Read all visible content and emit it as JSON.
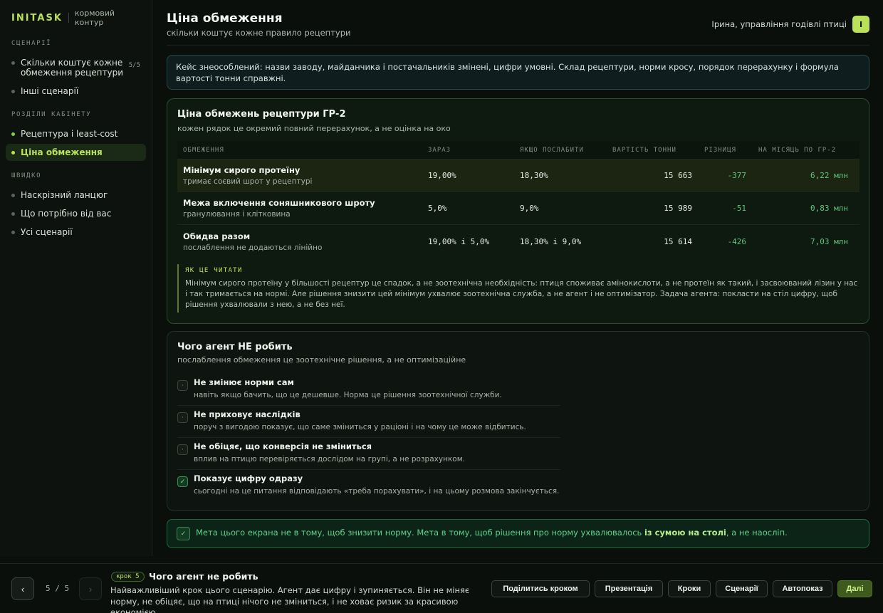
{
  "brand": {
    "name": "INITASK",
    "subtitle": "кормовий контур"
  },
  "sidebar": {
    "sections": [
      {
        "title": "СЦЕНАРІЇ",
        "items": [
          {
            "label": "Скільки коштує кожне обмеження рецептури",
            "count": "5/5"
          },
          {
            "label": "Інші сценарії"
          }
        ]
      },
      {
        "title": "РОЗДІЛИ КАБІНЕТУ",
        "items": [
          {
            "label": "Рецептура і least-cost"
          },
          {
            "label": "Ціна обмеження"
          }
        ]
      },
      {
        "title": "ШВИДКО",
        "items": [
          {
            "label": "Наскрізний ланцюг"
          },
          {
            "label": "Що потрібно від вас"
          },
          {
            "label": "Усі сценарії"
          }
        ]
      }
    ]
  },
  "header": {
    "title": "Ціна обмеження",
    "subtitle": "скільки коштує кожне правило рецептури",
    "user": "Ірина, управління годівлі птиці",
    "avatar": "І"
  },
  "notice": "Кейс знеособлений: назви заводу, майданчика і постачальників змінені, цифри умовні. Склад рецептури, норми кросу, порядок перерахунку і формула вартості тонни справжні.",
  "constraints_card": {
    "title": "Ціна обмежень рецептури ГР-2",
    "subtitle": "кожен рядок це окремий повний перерахунок, а не оцінка на око",
    "columns": [
      "ОБМЕЖЕННЯ",
      "ЗАРАЗ",
      "ЯКЩО ПОСЛАБИТИ",
      "ВАРТІСТЬ ТОННИ",
      "РІЗНИЦЯ",
      "НА МІСЯЦЬ ПО ГР-2"
    ],
    "rows": [
      {
        "name": "Мінімум сирого протеїну",
        "desc": "тримає соєвий шрот у рецептурі",
        "now": "19,00%",
        "relaxed": "18,30%",
        "cost": "15 663",
        "diff": "-377",
        "monthly": "6,22 млн"
      },
      {
        "name": "Межа включення соняшникового шроту",
        "desc": "гранулювання і клітковина",
        "now": "5,0%",
        "relaxed": "9,0%",
        "cost": "15 989",
        "diff": "-51",
        "monthly": "0,83 млн"
      },
      {
        "name": "Обидва разом",
        "desc": "послаблення не додаються лінійно",
        "now": "19,00% і 5,0%",
        "relaxed": "18,30% і 9,0%",
        "cost": "15 614",
        "diff": "-426",
        "monthly": "7,03 млн"
      }
    ],
    "howto_label": "ЯК ЦЕ ЧИТАТИ",
    "howto_text": "Мінімум сирого протеїну у більшості рецептур це спадок, а не зоотехнічна необхідність: птиця споживає амінокислоти, а не протеїн як такий, і засвоюваний лізин у нас і так тримається на нормі. Але рішення знизити цей мінімум ухвалює зоотехнічна служба, а не агент і не оптимізатор. Задача агента: покласти на стіл цифру, щоб рішення ухвалювали з нею, а не без неї."
  },
  "rules_card": {
    "title": "Чого агент НЕ робить",
    "subtitle": "послаблення обмеження це зоотехнічне рішення, а не оптимізаційне",
    "items": [
      {
        "title": "Не змінює норми сам",
        "desc": "навіть якщо бачить, що це дешевше. Норма це рішення зоотехнічної служби.",
        "mark": "·",
        "checked": false
      },
      {
        "title": "Не приховує наслідків",
        "desc": "поруч з вигодою показує, що саме зміниться у раціоні і на чому це може відбитись.",
        "mark": "·",
        "checked": false
      },
      {
        "title": "Не обіцяє, що конверсія не зміниться",
        "desc": "вплив на птицю перевіряється дослідом на групі, а не розрахунком.",
        "mark": "·",
        "checked": false
      },
      {
        "title": "Показує цифру одразу",
        "desc": "сьогодні на це питання відповідають «треба порахувати», і на цьому розмова закінчується.",
        "mark": "✓",
        "checked": true
      }
    ]
  },
  "goal": {
    "mark": "✓",
    "before": "Мета цього екрана не в тому, щоб знизити норму. Мета в тому, щоб рішення про норму ухвалювалось ",
    "bold": "із сумою на столі",
    "after": ", а не наосліп."
  },
  "footer": {
    "prev": "‹",
    "next": "›",
    "pager": "5 / 5",
    "step_badge": "крок 5",
    "step_title": "Чого агент не робить",
    "step_desc": "Найважливіший крок цього сценарію. Агент дає цифру і зупиняється. Він не міняє норму, не обіцяє, що на птиці нічого не зміниться, і не ховає ризик за красивою економією.",
    "buttons": {
      "share": "Поділитись кроком",
      "present": "Презентація",
      "steps": "Кроки",
      "scenarios": "Сценарії",
      "autoplay": "Автопоказ",
      "next": "Далі"
    }
  },
  "colors": {
    "accent": "#b9e15a",
    "positive": "#62c27e",
    "background": "#0b0f0c"
  }
}
